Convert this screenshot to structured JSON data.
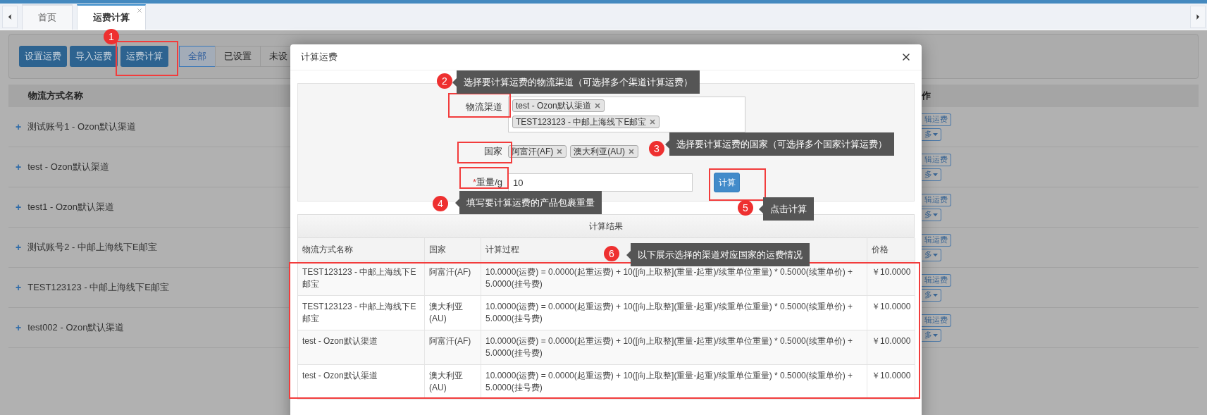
{
  "tabs": [
    {
      "label": "首页",
      "selected": false,
      "closable": false
    },
    {
      "label": "运费计算",
      "selected": true,
      "closable": true
    }
  ],
  "toolbar": {
    "buttons": [
      "设置运费",
      "导入运费",
      "运费计算"
    ],
    "filters": [
      {
        "label": "全部",
        "selected": true
      },
      {
        "label": "已设置",
        "selected": false
      },
      {
        "label": "未设",
        "selected": false
      }
    ]
  },
  "table": {
    "columns": [
      "物流方式名称",
      "作"
    ],
    "rows": [
      {
        "toggle": "+",
        "name": "测试账号1 - Ozon默认渠道",
        "actions": [
          "辑运费",
          "多"
        ]
      },
      {
        "toggle": "+",
        "name": "test - Ozon默认渠道",
        "actions": [
          "辑运费",
          "多"
        ]
      },
      {
        "toggle": "+",
        "name": "test1 - Ozon默认渠道",
        "actions": [
          "辑运费",
          "多"
        ]
      },
      {
        "toggle": "+",
        "name": "测试账号2 - 中邮上海线下E邮宝",
        "actions": [
          "辑运费",
          "多"
        ]
      },
      {
        "toggle": "+",
        "name": "TEST123123 - 中邮上海线下E邮宝",
        "actions": [
          "辑运费",
          "多"
        ]
      },
      {
        "toggle": "+",
        "name": "test002 - Ozon默认渠道",
        "actions": [
          "辑运费",
          "多"
        ]
      }
    ]
  },
  "modal": {
    "title": "计算运费",
    "form": {
      "channel_label": "物流渠道",
      "channels": [
        "test - Ozon默认渠道",
        "TEST123123 - 中邮上海线下E邮宝"
      ],
      "country_label": "国家",
      "countries": [
        "阿富汗(AF)",
        "澳大利亚(AU)"
      ],
      "weight_required_mark": "*",
      "weight_label": "重量/g",
      "weight_value": "10",
      "submit": "计算"
    },
    "results": {
      "title": "计算结果",
      "columns": [
        "物流方式名称",
        "国家",
        "计算过程",
        "价格"
      ],
      "rows": [
        {
          "name": "TEST123123 - 中邮上海线下E邮宝",
          "country": "阿富汗(AF)",
          "process": "10.0000(运费) = 0.0000(起重运费) + 10([向上取整](重量-起重)/续重单位重量) * 0.5000(续重单价) + 5.0000(挂号费)",
          "price": "￥10.0000"
        },
        {
          "name": "TEST123123 - 中邮上海线下E邮宝",
          "country": "澳大利亚(AU)",
          "process": "10.0000(运费) = 0.0000(起重运费) + 10([向上取整](重量-起重)/续重单位重量) * 0.5000(续重单价) + 5.0000(挂号费)",
          "price": "￥10.0000"
        },
        {
          "name": "test - Ozon默认渠道",
          "country": "阿富汗(AF)",
          "process": "10.0000(运费) = 0.0000(起重运费) + 10([向上取整](重量-起重)/续重单位重量) * 0.5000(续重单价) + 5.0000(挂号费)",
          "price": "￥10.0000"
        },
        {
          "name": "test - Ozon默认渠道",
          "country": "澳大利亚(AU)",
          "process": "10.0000(运费) = 0.0000(起重运费) + 10([向上取整](重量-起重)/续重单位重量) * 0.5000(续重单价) + 5.0000(挂号费)",
          "price": "￥10.0000"
        }
      ]
    }
  },
  "annotations": [
    {
      "number": "1"
    },
    {
      "number": "2",
      "text": "选择要计算运费的物流渠道（可选择多个渠道计算运费）"
    },
    {
      "number": "3",
      "text": "选择要计算运费的国家（可选择多个国家计算运费）"
    },
    {
      "number": "4",
      "text": "填写要计算运费的产品包裹重量"
    },
    {
      "number": "5",
      "text": "点击计算"
    },
    {
      "number": "6",
      "text": "以下展示选择的渠道对应国家的运费情况"
    }
  ]
}
